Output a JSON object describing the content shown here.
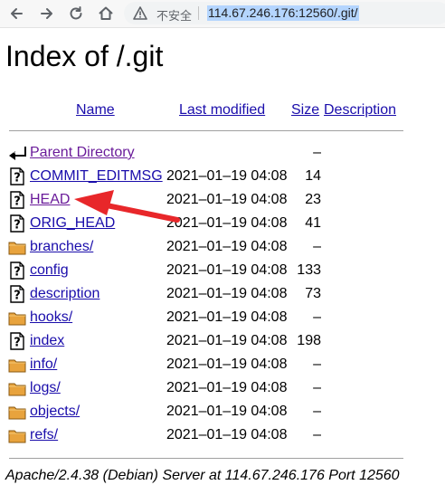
{
  "browser": {
    "insecure_label": "不安全",
    "url": "114.67.246.176:12560/.git/"
  },
  "page": {
    "title": "Index of /.git",
    "columns": {
      "name": "Name",
      "last_modified": "Last modified",
      "size": "Size",
      "description": "Description"
    },
    "parent": {
      "label": "Parent Directory",
      "size": "–"
    },
    "entries": [
      {
        "name": "COMMIT_EDITMSG",
        "type": "file",
        "modified": "2021–01–19 04:08",
        "size": "14"
      },
      {
        "name": "HEAD",
        "type": "file",
        "modified": "2021–01–19 04:08",
        "size": "23"
      },
      {
        "name": "ORIG_HEAD",
        "type": "file",
        "modified": "2021–01–19 04:08",
        "size": "41"
      },
      {
        "name": "branches/",
        "type": "folder",
        "modified": "2021–01–19 04:08",
        "size": "–"
      },
      {
        "name": "config",
        "type": "file",
        "modified": "2021–01–19 04:08",
        "size": "133"
      },
      {
        "name": "description",
        "type": "file",
        "modified": "2021–01–19 04:08",
        "size": "73"
      },
      {
        "name": "hooks/",
        "type": "folder",
        "modified": "2021–01–19 04:08",
        "size": "–"
      },
      {
        "name": "index",
        "type": "file",
        "modified": "2021–01–19 04:08",
        "size": "198"
      },
      {
        "name": "info/",
        "type": "folder",
        "modified": "2021–01–19 04:08",
        "size": "–"
      },
      {
        "name": "logs/",
        "type": "folder",
        "modified": "2021–01–19 04:08",
        "size": "–"
      },
      {
        "name": "objects/",
        "type": "folder",
        "modified": "2021–01–19 04:08",
        "size": "–"
      },
      {
        "name": "refs/",
        "type": "folder",
        "modified": "2021–01–19 04:08",
        "size": "–"
      }
    ],
    "footer": "Apache/2.4.38 (Debian) Server at 114.67.246.176 Port 12560"
  },
  "annotation": {
    "color": "#e8272a",
    "points_to": "HEAD"
  }
}
